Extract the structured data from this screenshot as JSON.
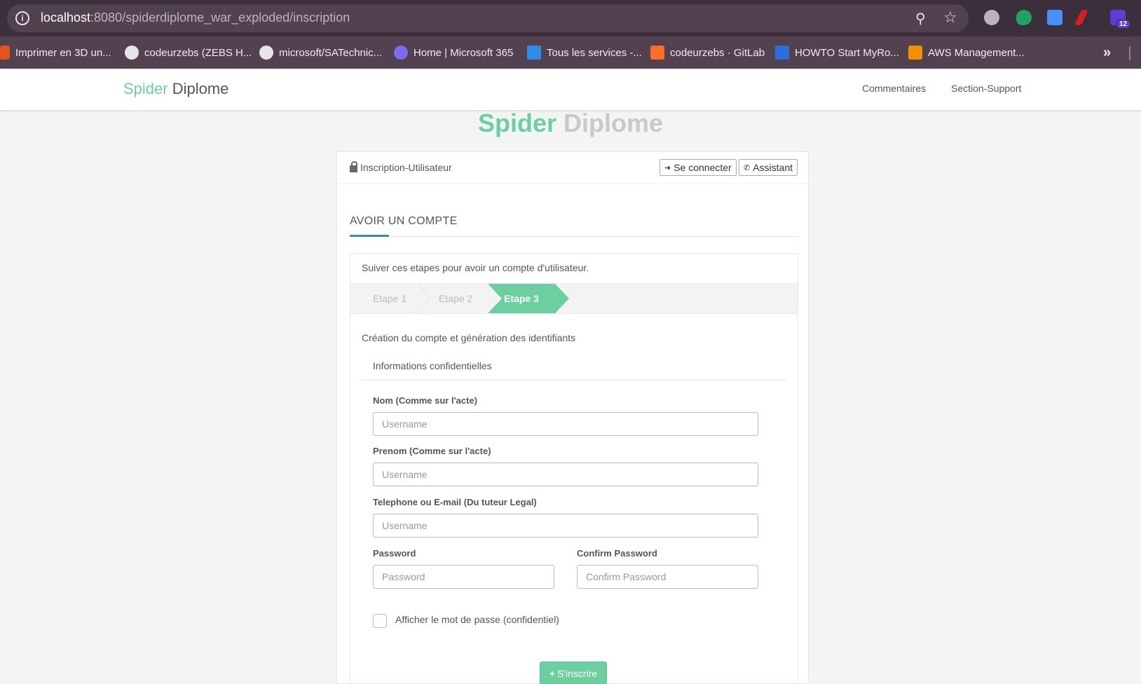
{
  "browser": {
    "url_host": "localhost",
    "url_path": ":8080/spiderdiplome_war_exploded/inscription",
    "extension_badge": "12"
  },
  "bookmarks": [
    {
      "label": "Imprimer en 3D un...",
      "icon": "3d-print-icon",
      "color": "#e8541e"
    },
    {
      "label": "codeurzebs (ZEBS H...",
      "icon": "github-icon",
      "color": "#e6e6e6"
    },
    {
      "label": "microsoft/SATechnic...",
      "icon": "github-icon",
      "color": "#e6e6e6"
    },
    {
      "label": "Home | Microsoft 365",
      "icon": "microsoft365-icon",
      "color": "#7b6cf0"
    },
    {
      "label": "Tous les services -...",
      "icon": "azure-icon",
      "color": "#2f8be6"
    },
    {
      "label": "codeurzebs · GitLab",
      "icon": "gitlab-icon",
      "color": "#fc6d26"
    },
    {
      "label": "HOWTO Start MyRo...",
      "icon": "page-icon",
      "color": "#2a6fdb"
    },
    {
      "label": "AWS Management...",
      "icon": "aws-icon",
      "color": "#f29100"
    }
  ],
  "nav": {
    "brand_green": "Spider",
    "brand_rest": "Diplome",
    "links": [
      "Commentaires",
      "Section-Support"
    ]
  },
  "hero": {
    "green": "Spider",
    "rest": "Diplome"
  },
  "card": {
    "title": "Inscription-Utilisateur",
    "login_button": "Se connecter",
    "assistant_button": "Assistant"
  },
  "section": {
    "title": "AVOIR UN COMPTE"
  },
  "wizard": {
    "intro": "Suiver ces etapes pour avoir un compte d'utilisateur.",
    "steps": [
      "Etape 1",
      "Etape 2",
      "Etape 3"
    ],
    "active_step": 3,
    "step_description": "Création du compte et génération des identifiants",
    "subsection": "Informations confidentielles"
  },
  "form": {
    "nom_label": "Nom (Comme sur l'acte)",
    "nom_placeholder": "Username",
    "prenom_label": "Prenom (Comme sur l'acte)",
    "prenom_placeholder": "Username",
    "contact_label": "Telephone ou E-mail (Du tuteur Legal)",
    "contact_placeholder": "Username",
    "password_label": "Password",
    "password_placeholder": "Password",
    "confirm_label": "Confirm Password",
    "confirm_placeholder": "Confirm Password",
    "show_password_label": "Afficher le mot de passe (confidentiel)",
    "submit_label": "S'inscrire"
  },
  "colors": {
    "accent": "#6ccf9f",
    "underline": "#3f86b8",
    "chrome": "#3c2f3c"
  }
}
